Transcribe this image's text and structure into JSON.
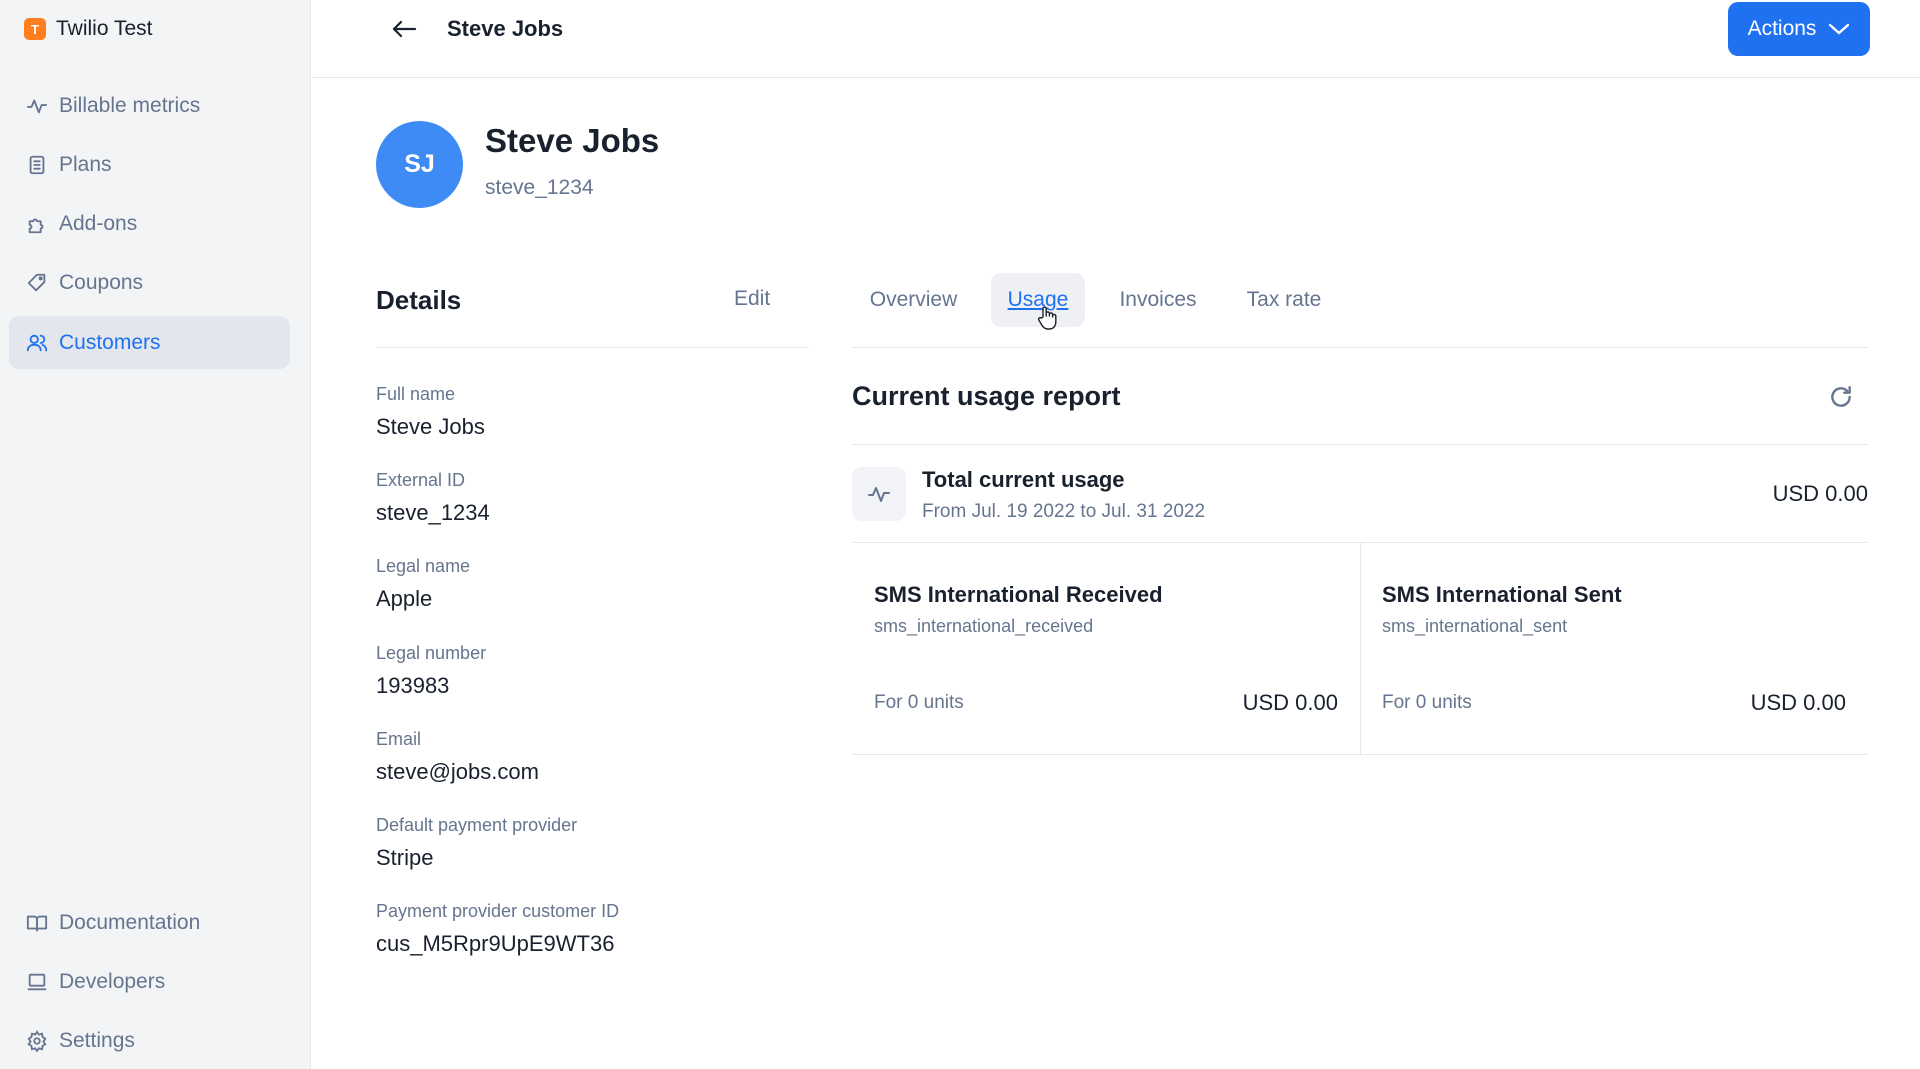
{
  "sidebar": {
    "org_initial": "T",
    "org_name": "Twilio Test",
    "nav_top": [
      {
        "label": "Billable metrics",
        "icon": "pulse-icon"
      },
      {
        "label": "Plans",
        "icon": "clipboard-icon"
      },
      {
        "label": "Add-ons",
        "icon": "puzzle-icon"
      },
      {
        "label": "Coupons",
        "icon": "tag-icon"
      },
      {
        "label": "Customers",
        "icon": "users-icon"
      }
    ],
    "active_item": "Customers",
    "nav_bottom": [
      {
        "label": "Documentation",
        "icon": "book-icon"
      },
      {
        "label": "Developers",
        "icon": "laptop-icon"
      },
      {
        "label": "Settings",
        "icon": "gear-icon"
      }
    ]
  },
  "header": {
    "title": "Steve Jobs",
    "actions_label": "Actions"
  },
  "profile": {
    "initials": "SJ",
    "name": "Steve Jobs",
    "external_id": "steve_1234"
  },
  "details": {
    "title": "Details",
    "edit_label": "Edit",
    "fields": [
      {
        "label": "Full name",
        "value": "Steve Jobs"
      },
      {
        "label": "External ID",
        "value": "steve_1234"
      },
      {
        "label": "Legal name",
        "value": "Apple"
      },
      {
        "label": "Legal number",
        "value": "193983"
      },
      {
        "label": "Email",
        "value": "steve@jobs.com"
      },
      {
        "label": "Default payment provider",
        "value": "Stripe"
      },
      {
        "label": "Payment provider customer ID",
        "value": "cus_M5Rpr9UpE9WT36"
      }
    ]
  },
  "tabs": [
    {
      "label": "Overview"
    },
    {
      "label": "Usage"
    },
    {
      "label": "Invoices"
    },
    {
      "label": "Tax rate"
    }
  ],
  "active_tab": "Usage",
  "usage": {
    "title": "Current usage report",
    "total_title": "Total current usage",
    "total_period": "From Jul. 19 2022 to Jul. 31 2022",
    "total_amount": "USD 0.00",
    "items": [
      {
        "name": "SMS International Received",
        "code": "sms_international_received",
        "units": "For 0 units",
        "amount": "USD 0.00"
      },
      {
        "name": "SMS International Sent",
        "code": "sms_international_sent",
        "units": "For 0 units",
        "amount": "USD 0.00"
      }
    ]
  },
  "colors": {
    "accent": "#1f71f0",
    "avatar": "#3f8bf5",
    "org_logo": "#ff7e1d",
    "sidebar_bg": "#f3f4f6",
    "muted_text": "#66758f"
  }
}
